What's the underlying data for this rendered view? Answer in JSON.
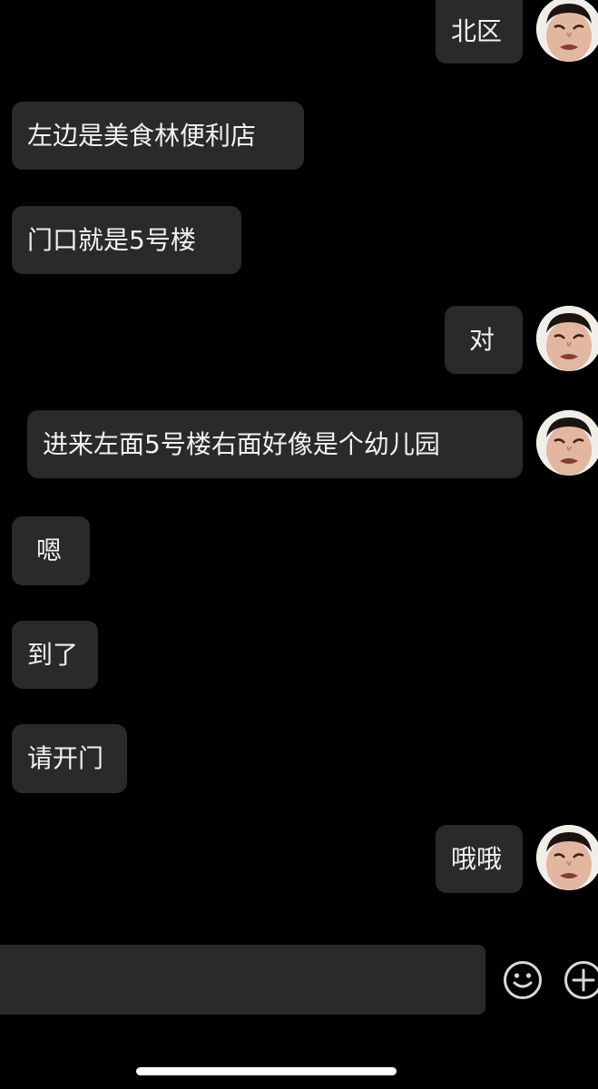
{
  "messages": [
    {
      "side": "right",
      "text": "北区"
    },
    {
      "side": "left",
      "text": "左边是美食林便利店"
    },
    {
      "side": "left",
      "text": "门口就是5号楼"
    },
    {
      "side": "right",
      "text": "对"
    },
    {
      "side": "right",
      "text": "进来左面5号楼右面好像是个幼儿园"
    },
    {
      "side": "left",
      "text": "嗯"
    },
    {
      "side": "left",
      "text": "到了"
    },
    {
      "side": "left",
      "text": "请开门"
    },
    {
      "side": "right",
      "text": "哦哦"
    }
  ],
  "input_bar": {
    "value": ""
  },
  "icons": {
    "emoji": "smiley-face-icon",
    "plus": "plus-circle-icon"
  },
  "colors": {
    "background": "#000000",
    "bubble": "#2a2a2a",
    "text": "#f2f2f2",
    "icon": "#d8d8d8"
  }
}
